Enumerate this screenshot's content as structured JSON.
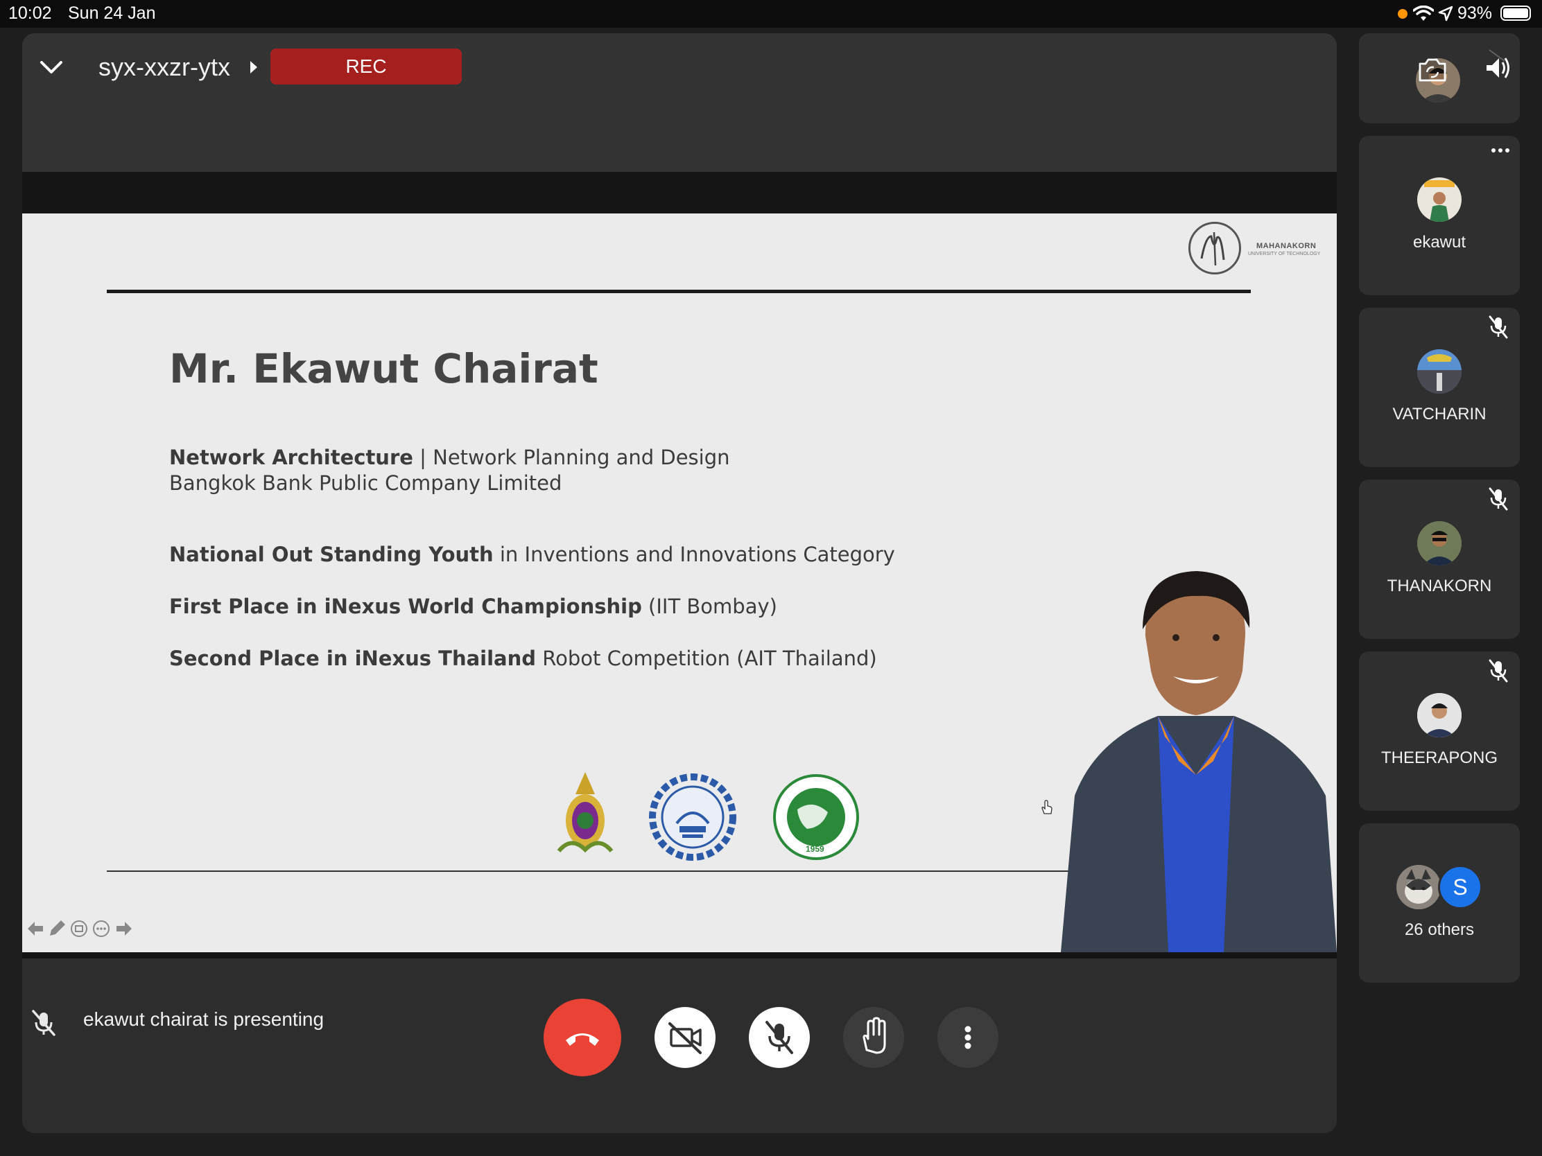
{
  "status_bar": {
    "time": "10:02",
    "date": "Sun 24 Jan",
    "battery": "93%"
  },
  "meeting": {
    "code": "syx-xxzr-ytx",
    "rec_label": "REC"
  },
  "slide": {
    "logo_text": "MAHANAKORN",
    "logo_subtext": "UNIVERSITY OF TECHNOLOGY",
    "name": "Mr. Ekawut Chairat",
    "role_bold": "Network Architecture",
    "role_rest": " | Network Planning and Design",
    "company": "Bangkok Bank Public Company Limited",
    "award1_bold": "National Out Standing Youth",
    "award1_rest": " in Inventions and Innovations Category",
    "award2_bold": "First Place in iNexus World Championship",
    "award2_rest": " (IIT Bombay)",
    "award3_bold": "Second Place in iNexus Thailand",
    "award3_rest": " Robot Competition (AIT Thailand)",
    "ait_year": "1959"
  },
  "presenting_text": "ekawut chairat is presenting",
  "participants": [
    {
      "name": "ekawut"
    },
    {
      "name": "VATCHARIN"
    },
    {
      "name": "THANAKORN"
    },
    {
      "name": "THEERAPONG"
    }
  ],
  "others": {
    "label": "26 others",
    "avatar_letter": "S"
  },
  "colors": {
    "rec": "#a51f1f",
    "end_call": "#ea4335",
    "letter_avatar": "#1a73e8"
  }
}
